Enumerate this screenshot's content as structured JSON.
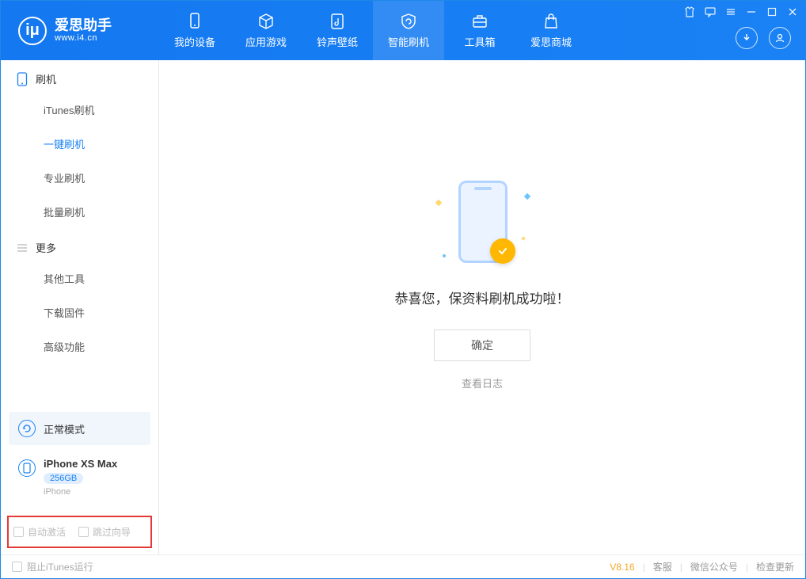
{
  "app": {
    "title": "爱思助手",
    "subtitle": "www.i4.cn",
    "logo_letter": "iμ"
  },
  "tabs": [
    {
      "label": "我的设备"
    },
    {
      "label": "应用游戏"
    },
    {
      "label": "铃声壁纸"
    },
    {
      "label": "智能刷机"
    },
    {
      "label": "工具箱"
    },
    {
      "label": "爱思商城"
    }
  ],
  "sidebar": {
    "section1_title": "刷机",
    "items1": [
      "iTunes刷机",
      "一键刷机",
      "专业刷机",
      "批量刷机"
    ],
    "section2_title": "更多",
    "items2": [
      "其他工具",
      "下载固件",
      "高级功能"
    ]
  },
  "mode_card": {
    "label": "正常模式"
  },
  "device": {
    "name": "iPhone XS Max",
    "capacity": "256GB",
    "type": "iPhone"
  },
  "options": {
    "auto_activate": "自动激活",
    "skip_guide": "跳过向导"
  },
  "main": {
    "success_message": "恭喜您，保资料刷机成功啦！",
    "ok_button": "确定",
    "view_log": "查看日志"
  },
  "footer": {
    "block_itunes": "阻止iTunes运行",
    "version": "V8.16",
    "links": [
      "客服",
      "微信公众号",
      "检查更新"
    ]
  }
}
